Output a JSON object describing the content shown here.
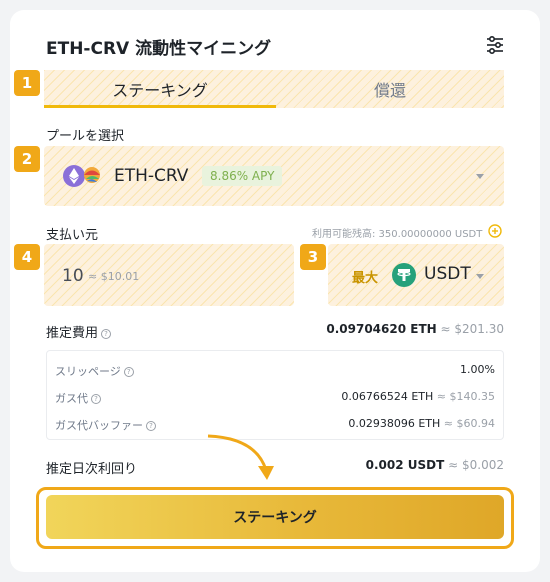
{
  "header": {
    "title": "ETH-CRV 流動性マイニング",
    "settings_icon": "settings-sliders-icon"
  },
  "badges": [
    "1",
    "2",
    "3",
    "4"
  ],
  "tabs": [
    {
      "label": "ステーキング",
      "active": true
    },
    {
      "label": "償還",
      "active": false
    }
  ],
  "pool": {
    "section_label": "プールを選択",
    "token": "ETH-CRV",
    "apy": "8.86% APY"
  },
  "payment": {
    "section_label": "支払い元",
    "balance_label": "利用可能残高: 350.00000000 USDT",
    "amount": "10",
    "amount_usd": "≈ $10.01",
    "max_label": "最大",
    "token": "USDT"
  },
  "fee": {
    "label": "推定費用",
    "value": "0.09704620 ETH",
    "value_usd": "≈ $201.30",
    "rows": [
      {
        "label": "スリッページ",
        "value": "1.00%",
        "sub": ""
      },
      {
        "label": "ガス代",
        "value": "0.06766524 ETH",
        "sub": "≈ $140.35"
      },
      {
        "label": "ガス代バッファー",
        "value": "0.02938096 ETH",
        "sub": "≈ $60.94"
      }
    ]
  },
  "daily_yield": {
    "label": "推定日次利回り",
    "value": "0.002 USDT",
    "value_usd": "≈ $0.002"
  },
  "submit": {
    "label": "ステーキング"
  },
  "colors": {
    "accent": "#f0b90b",
    "badge": "#f0a818",
    "apy_text": "#7fb04e",
    "usdt": "#26a17b"
  }
}
